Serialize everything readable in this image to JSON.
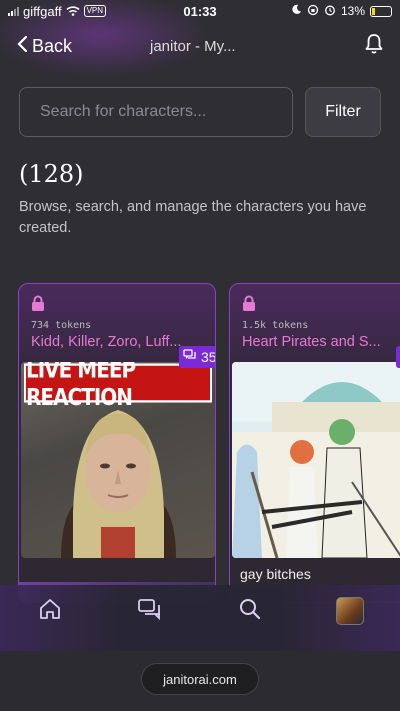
{
  "status_bar": {
    "carrier": "giffgaff",
    "vpn_label": "VPN",
    "time": "01:33",
    "battery_percent": "13%"
  },
  "nav": {
    "back_label": "Back",
    "title": "janitor - My..."
  },
  "search": {
    "placeholder": "Search for characters...",
    "filter_label": "Filter"
  },
  "header": {
    "count": "(128)",
    "description": "Browse, search, and manage the characters you have created."
  },
  "cards": [
    {
      "tokens": "734 tokens",
      "title": "Kidd, Killer, Zoro, Luff...",
      "chats": "35",
      "image_text": "LIVE MEEP REACTION",
      "caption": ""
    },
    {
      "tokens": "1.5k tokens",
      "title": "Heart Pirates and S...",
      "chats": "",
      "image_text": "",
      "caption": "gay bitches"
    }
  ],
  "url_bar": {
    "url": "janitorai.com"
  },
  "colors": {
    "accent": "#7a2bd3",
    "title_pink": "#e47ad2",
    "background": "#2e2e33"
  }
}
